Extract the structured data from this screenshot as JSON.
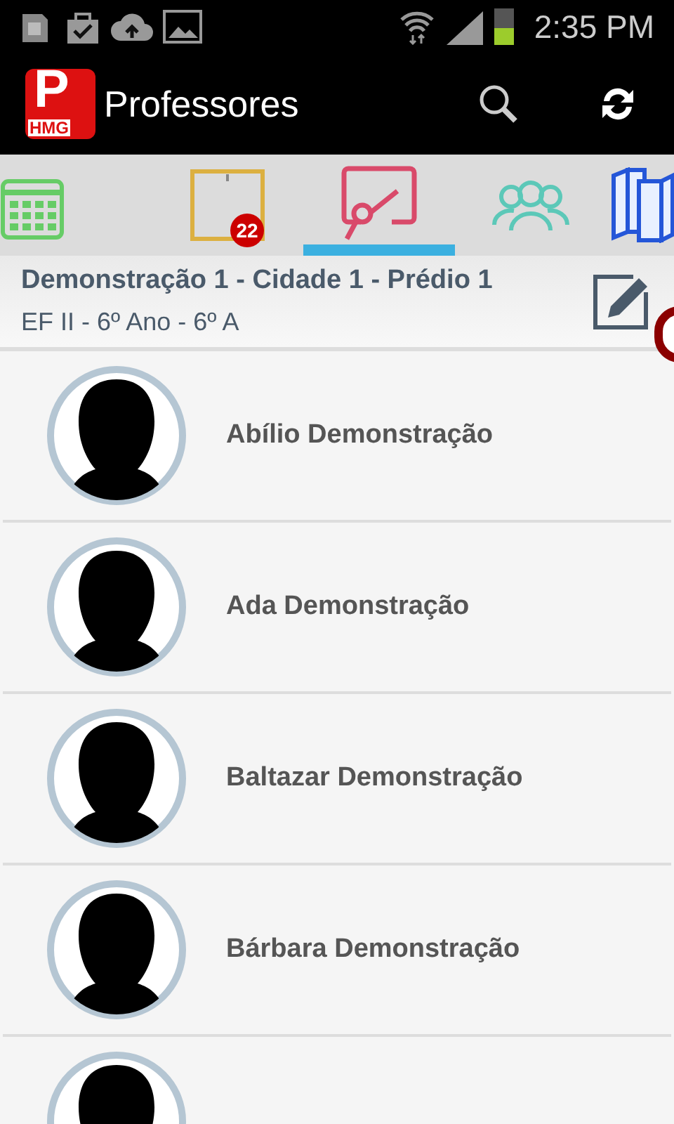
{
  "status_bar": {
    "time": "2:35 PM",
    "battery": {
      "level": 0.45
    }
  },
  "app_bar": {
    "logo_letter": "P",
    "logo_badge": "HMG",
    "title": "Professores"
  },
  "tabs": [
    {
      "kind": "calendar",
      "selected": false
    },
    {
      "kind": "notes",
      "selected": false,
      "badge": "22"
    },
    {
      "kind": "board",
      "selected": true
    },
    {
      "kind": "people",
      "selected": false
    },
    {
      "kind": "books",
      "selected": false
    }
  ],
  "header": {
    "title": "Demonstração 1 - Cidade 1 - Prédio 1",
    "subtitle": "EF II - 6º Ano - 6º A"
  },
  "teachers": [
    {
      "kind": "full",
      "name": "Abílio Demonstração"
    },
    {
      "kind": "full",
      "name": "Ada Demonstração"
    },
    {
      "kind": "full",
      "name": "Baltazar Demonstração"
    },
    {
      "kind": "full",
      "name": "Bárbara Demonstração"
    },
    {
      "kind": "cut"
    }
  ]
}
